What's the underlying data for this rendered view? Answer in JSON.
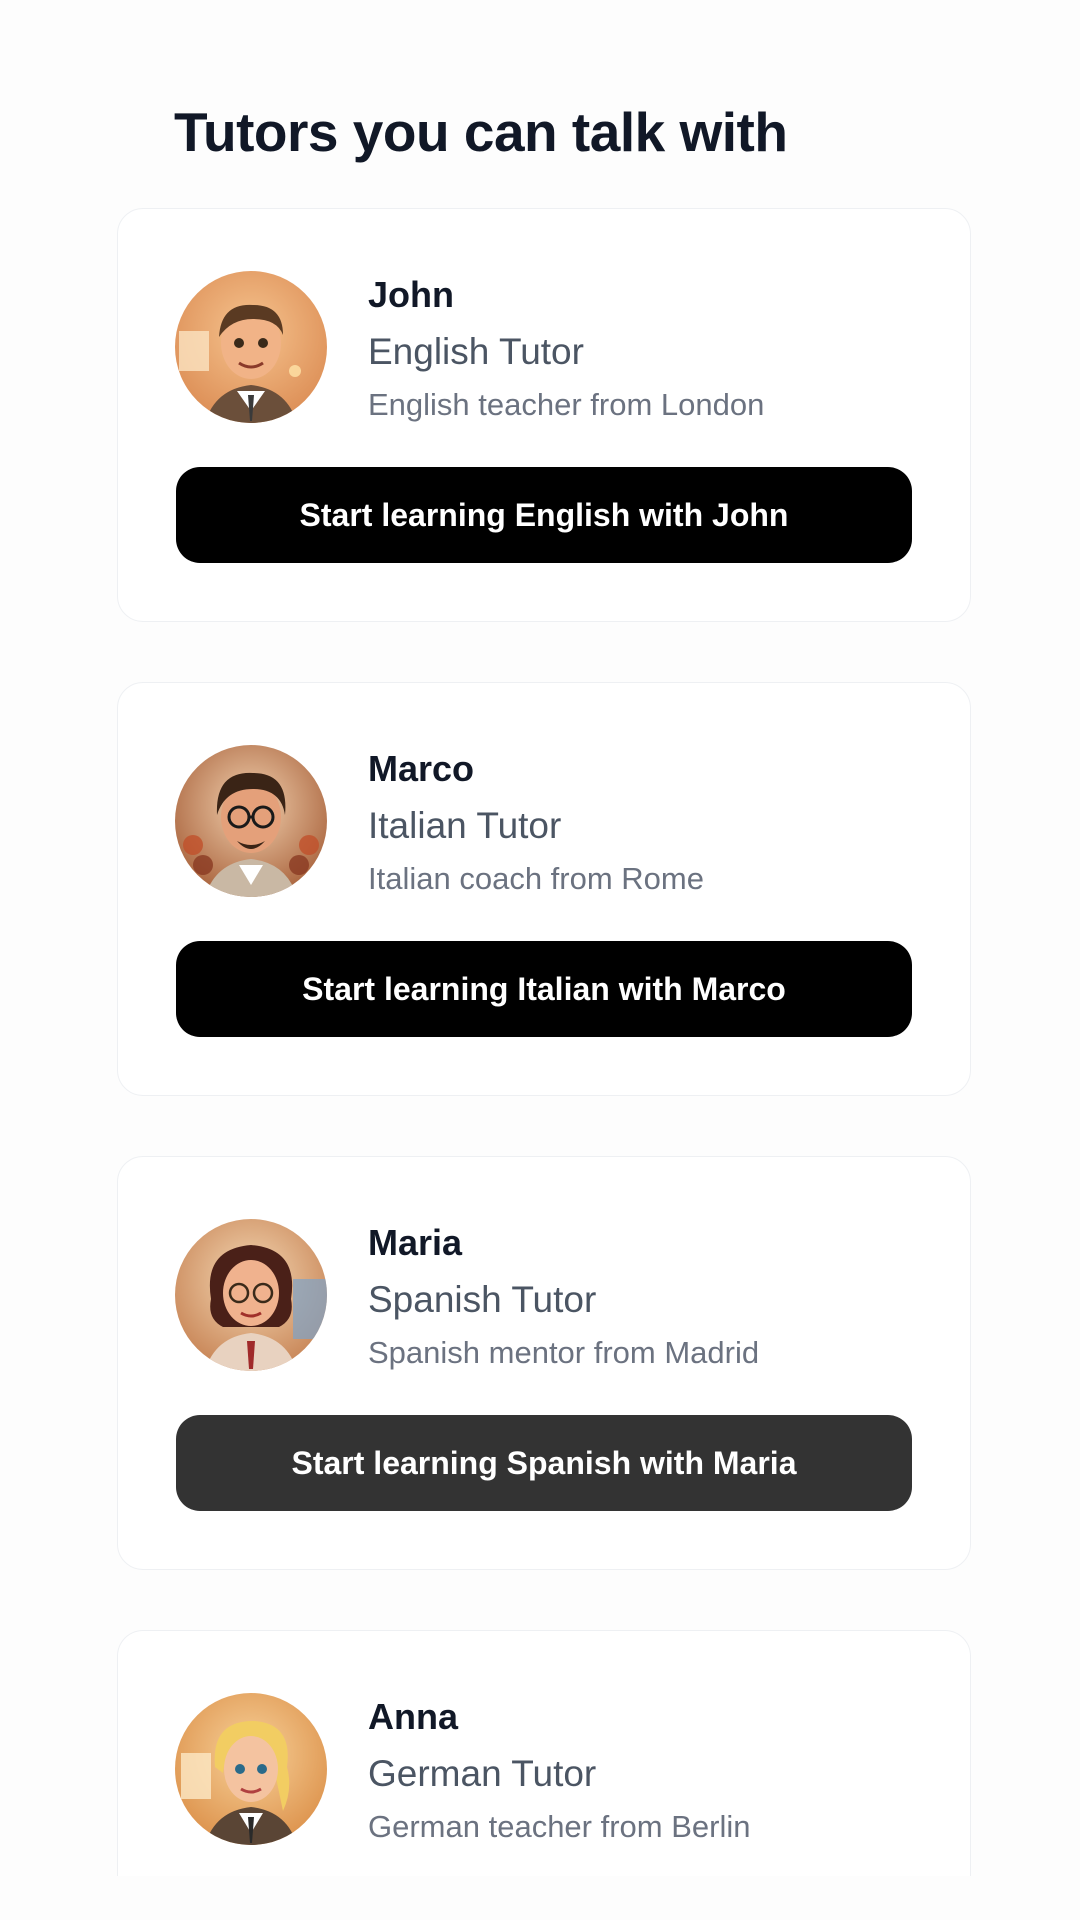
{
  "page": {
    "title": "Tutors you can talk with"
  },
  "tutors": [
    {
      "name": "John",
      "role": "English Tutor",
      "description": "English teacher from London",
      "button_label": "Start learning English with John"
    },
    {
      "name": "Marco",
      "role": "Italian Tutor",
      "description": "Italian coach from Rome",
      "button_label": "Start learning Italian with Marco"
    },
    {
      "name": "Maria",
      "role": "Spanish Tutor",
      "description": "Spanish mentor from Madrid",
      "button_label": "Start learning Spanish with Maria"
    },
    {
      "name": "Anna",
      "role": "German Tutor",
      "description": "German teacher from Berlin"
    }
  ],
  "colors": {
    "heading": "#111827",
    "role_text": "#4b5563",
    "desc_text": "#6b7280",
    "button_bg": "#000000",
    "button_hover_bg": "#333333",
    "button_text": "#ffffff",
    "card_border": "#eef0f3"
  },
  "icons": {
    "avatars": [
      "john-avatar",
      "marco-avatar",
      "maria-avatar",
      "anna-avatar"
    ]
  }
}
